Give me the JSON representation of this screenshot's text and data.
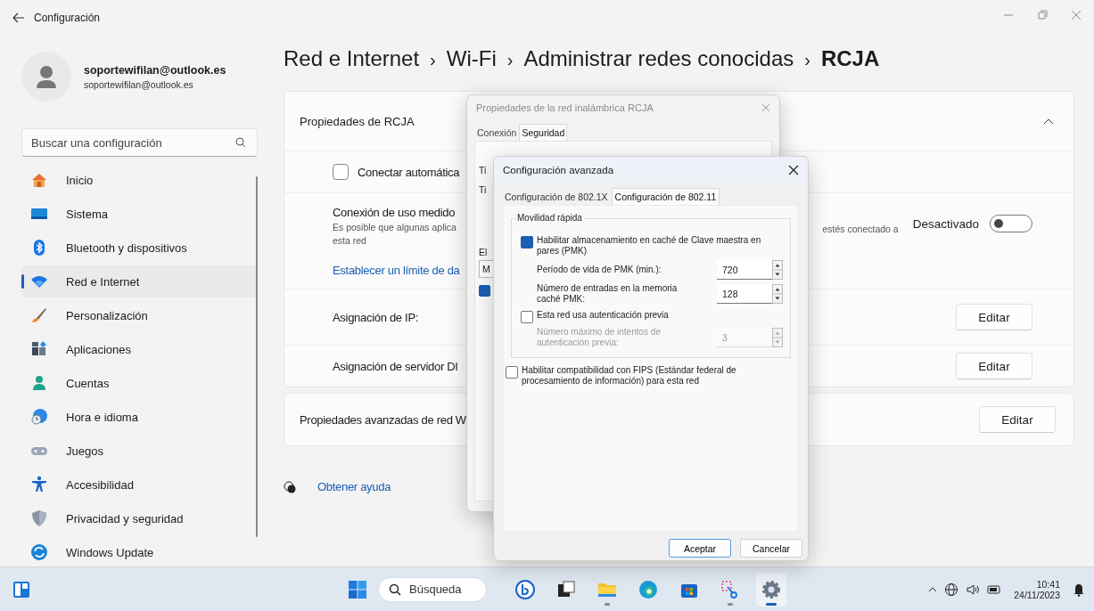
{
  "window": {
    "title": "Configuración"
  },
  "account": {
    "name": "soportewifilan@outlook.es",
    "email": "soportewifilan@outlook.es"
  },
  "search": {
    "placeholder": "Buscar una configuración"
  },
  "sidebar": {
    "items": [
      {
        "kind": "home",
        "label": "Inicio",
        "selected": false
      },
      {
        "kind": "system",
        "label": "Sistema",
        "selected": false
      },
      {
        "kind": "bluetooth",
        "label": "Bluetooth y dispositivos",
        "selected": false
      },
      {
        "kind": "network",
        "label": "Red e Internet",
        "selected": true
      },
      {
        "kind": "personalization",
        "label": "Personalización",
        "selected": false
      },
      {
        "kind": "apps",
        "label": "Aplicaciones",
        "selected": false
      },
      {
        "kind": "accounts",
        "label": "Cuentas",
        "selected": false
      },
      {
        "kind": "time",
        "label": "Hora e idioma",
        "selected": false
      },
      {
        "kind": "gaming",
        "label": "Juegos",
        "selected": false
      },
      {
        "kind": "accessibility",
        "label": "Accesibilidad",
        "selected": false
      },
      {
        "kind": "privacy",
        "label": "Privacidad y seguridad",
        "selected": false
      },
      {
        "kind": "update",
        "label": "Windows Update",
        "selected": false
      }
    ]
  },
  "breadcrumb": [
    {
      "kind": "link",
      "text": "Red e Internet"
    },
    {
      "kind": "separator",
      "text": "›"
    },
    {
      "kind": "link",
      "text": "Wi-Fi"
    },
    {
      "kind": "separator",
      "text": "›"
    },
    {
      "kind": "link",
      "text": "Administrar redes conocidas"
    },
    {
      "kind": "separator",
      "text": "›"
    },
    {
      "kind": "current",
      "text": "RCJA"
    }
  ],
  "network_card": {
    "title": "Propiedades de RCJA",
    "expanded": true,
    "rows": [
      {
        "kind": "checkbox",
        "label": "Conectar automática",
        "checked": false
      },
      {
        "kind": "toggle",
        "title": "Conexión de uso medido",
        "description_lines": [
          "Es posible que algunas aplica",
          "esta red"
        ],
        "description_tail": "estés conectado a",
        "link": "Establecer un límite de da",
        "state_label": "Desactivado",
        "on": false
      },
      {
        "kind": "edit",
        "label": "Asignación de IP:",
        "button": "Editar"
      },
      {
        "kind": "edit",
        "label": "Asignación de servidor DI",
        "button": "Editar"
      }
    ]
  },
  "advanced_card": {
    "label": "Propiedades avanzadas de red W",
    "button": "Editar"
  },
  "help_link": "Obtener ayuda",
  "wireless_dialog": {
    "title": "Propiedades de la red inalámbrica RCJA",
    "active": false,
    "tabs": [
      {
        "label": "Conexión",
        "selected": false
      },
      {
        "label": "Seguridad",
        "selected": true
      }
    ],
    "fragments": [
      {
        "kind": "text",
        "text": "Ti"
      },
      {
        "kind": "text",
        "text": "Ti"
      },
      {
        "kind": "text",
        "text": "El"
      },
      {
        "kind": "field",
        "text": "M"
      },
      {
        "kind": "checkbox",
        "checked": true
      }
    ]
  },
  "advanced_dialog": {
    "title": "Configuración avanzada",
    "tabs": [
      {
        "label": "Configuración de 802.1X",
        "selected": false
      },
      {
        "label": "Configuración de 802.11",
        "selected": true
      }
    ],
    "group": {
      "title": "Movilidad rápida",
      "items": [
        {
          "kind": "checkbox",
          "label": "Habilitar almacenamiento en caché de Clave maestra en pares (PMK)",
          "checked": true,
          "disabled": false
        },
        {
          "kind": "spinner",
          "label": "Período de vida de PMK (min.):",
          "value": "720",
          "disabled": false
        },
        {
          "kind": "spinner",
          "label": "Número de entradas en la memoria caché PMK:",
          "value": "128",
          "disabled": false
        },
        {
          "kind": "checkbox",
          "label": "Esta red usa autenticación previa",
          "checked": false,
          "disabled": false
        },
        {
          "kind": "spinner",
          "label": "Número máximo de intentos de autenticación previa:",
          "value": "3",
          "disabled": true
        }
      ]
    },
    "fips": {
      "label": "Habilitar compatibilidad con FIPS (Estándar federal de procesamiento de información) para esta red",
      "checked": false
    },
    "buttons": [
      {
        "label": "Aceptar",
        "default": true
      },
      {
        "label": "Cancelar",
        "default": false
      }
    ]
  },
  "taskbar": {
    "search_placeholder": "Búsqueda",
    "apps": [
      {
        "kind": "copilot",
        "running": false,
        "active": false
      },
      {
        "kind": "taskview",
        "running": false,
        "active": false
      },
      {
        "kind": "explorer",
        "running": true,
        "active": false
      },
      {
        "kind": "edge",
        "running": false,
        "active": false
      },
      {
        "kind": "store",
        "running": false,
        "active": false
      },
      {
        "kind": "snip",
        "running": true,
        "active": false
      },
      {
        "kind": "settings",
        "running": true,
        "active": true
      }
    ],
    "time": "10:41",
    "date": "24/11/2023"
  }
}
